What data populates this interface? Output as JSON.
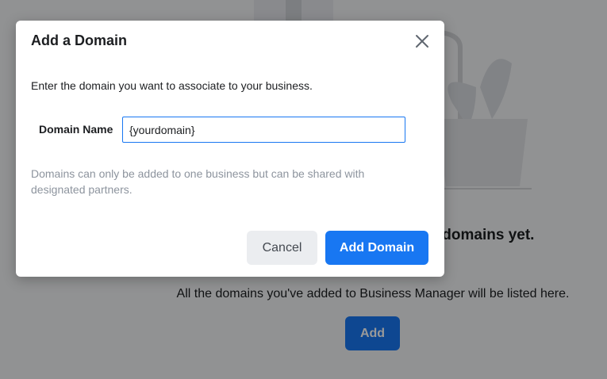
{
  "background": {
    "empty_title": "You don't have any domains yet.",
    "empty_subtitle": "All the domains you've added to Business Manager will be listed here.",
    "add_button_label": "Add"
  },
  "modal": {
    "title": "Add a Domain",
    "close_icon": "close-icon",
    "intro": "Enter the domain you want to associate to your business.",
    "domain_field": {
      "label": "Domain Name",
      "value": "{yourdomain}"
    },
    "help_text": "Domains can only be added to one business but can be shared with designated partners.",
    "cancel_label": "Cancel",
    "add_domain_label": "Add Domain"
  },
  "colors": {
    "accent": "#1877f2",
    "overlay": "rgba(0,0,0,0.40)",
    "help_text": "#8d949e"
  }
}
